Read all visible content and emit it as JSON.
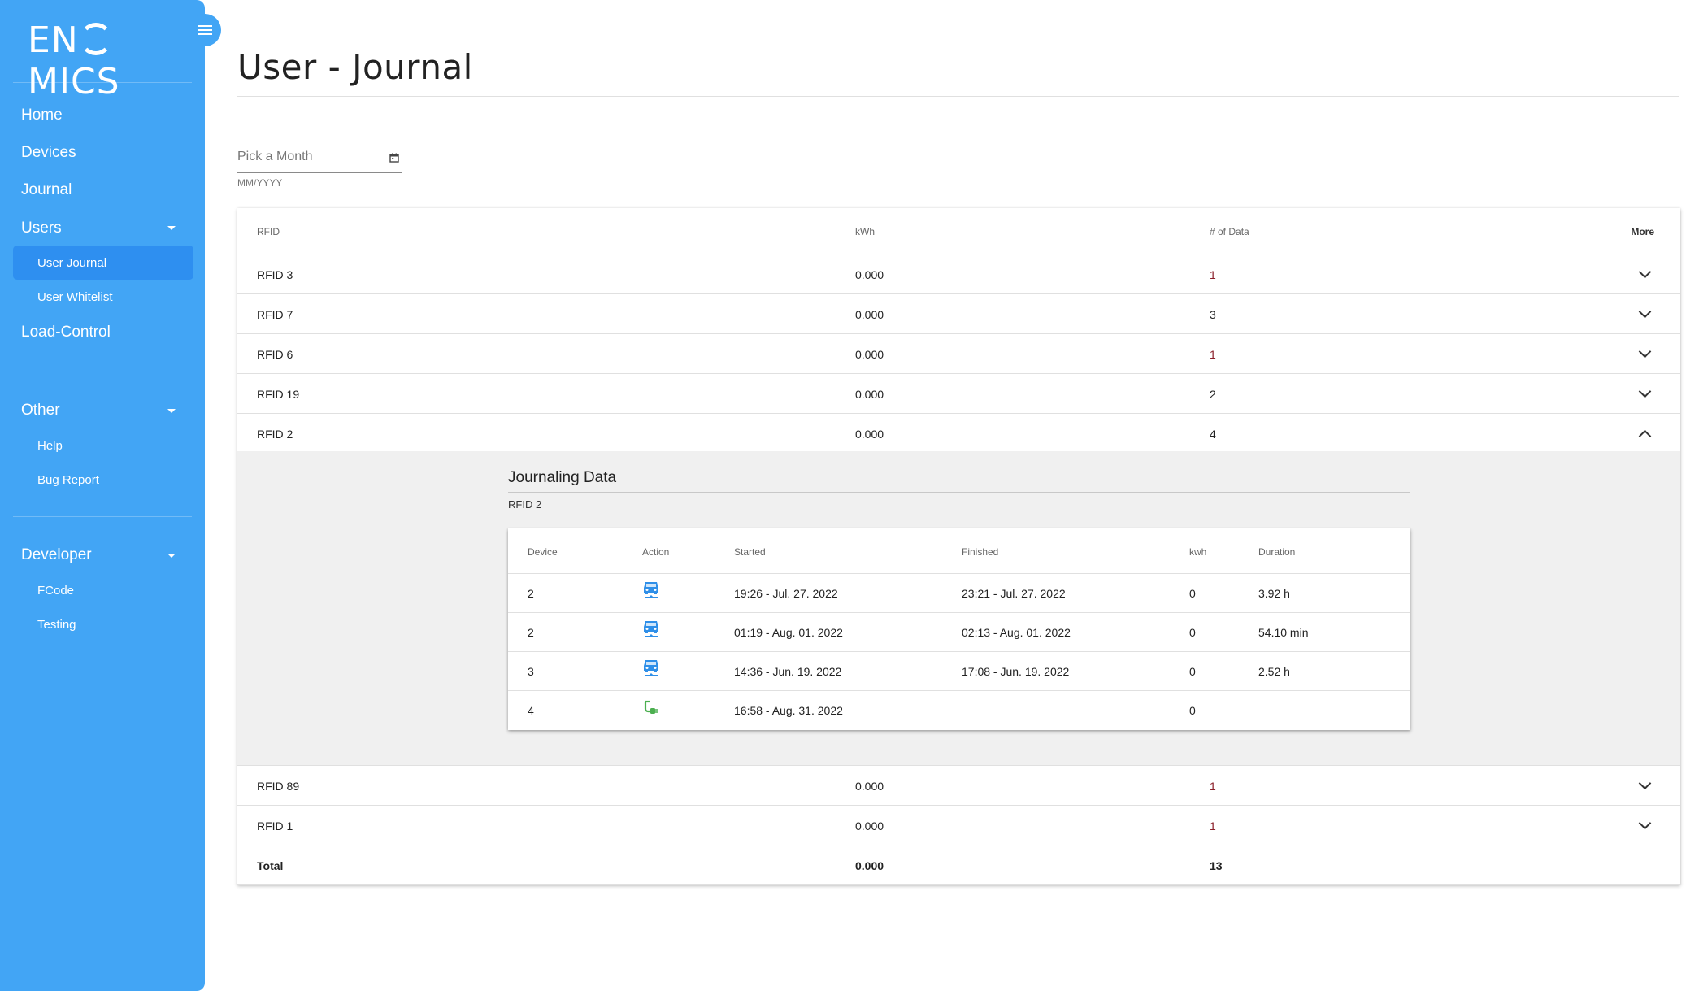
{
  "brand": {
    "logo_text_1": "EN",
    "logo_text_2": "MICS"
  },
  "sidebar": {
    "items": [
      {
        "label": "Home"
      },
      {
        "label": "Devices"
      },
      {
        "label": "Journal"
      },
      {
        "label": "Users"
      },
      {
        "label": "Load-Control"
      },
      {
        "label": "Other"
      },
      {
        "label": "Developer"
      }
    ],
    "users_sub": [
      {
        "label": "User Journal"
      },
      {
        "label": "User Whitelist"
      }
    ],
    "other_sub": [
      {
        "label": "Help"
      },
      {
        "label": "Bug Report"
      }
    ],
    "developer_sub": [
      {
        "label": "FCode"
      },
      {
        "label": "Testing"
      }
    ]
  },
  "page": {
    "title": "User - Journal"
  },
  "month_picker": {
    "placeholder": "Pick a Month",
    "hint": "MM/YYYY"
  },
  "table": {
    "headers": {
      "rfid": "RFID",
      "kwh": "kWh",
      "num": "# of Data",
      "more": "More"
    },
    "rows": [
      {
        "rfid": "RFID 3",
        "kwh": "0.000",
        "num": "1"
      },
      {
        "rfid": "RFID 7",
        "kwh": "0.000",
        "num": "3"
      },
      {
        "rfid": "RFID 6",
        "kwh": "0.000",
        "num": "1"
      },
      {
        "rfid": "RFID 19",
        "kwh": "0.000",
        "num": "2"
      },
      {
        "rfid": "RFID 2",
        "kwh": "0.000",
        "num": "4"
      },
      {
        "rfid": "RFID 89",
        "kwh": "0.000",
        "num": "1"
      },
      {
        "rfid": "RFID 1",
        "kwh": "0.000",
        "num": "1"
      }
    ],
    "total": {
      "label": "Total",
      "kwh": "0.000",
      "num": "13"
    }
  },
  "journaling": {
    "title": "Journaling Data",
    "subtitle": "RFID 2",
    "headers": {
      "device": "Device",
      "action": "Action",
      "started": "Started",
      "finished": "Finished",
      "kwh": "kwh",
      "duration": "Duration"
    },
    "rows": [
      {
        "device": "2",
        "action_icon": "car-icon",
        "started": "19:26 - Jul. 27. 2022",
        "finished": "23:21 - Jul. 27. 2022",
        "kwh": "0",
        "duration": "3.92 h"
      },
      {
        "device": "2",
        "action_icon": "car-icon",
        "started": "01:19 - Aug. 01. 2022",
        "finished": "02:13 - Aug. 01. 2022",
        "kwh": "0",
        "duration": "54.10 min"
      },
      {
        "device": "3",
        "action_icon": "car-icon",
        "started": "14:36 - Jun. 19. 2022",
        "finished": "17:08 - Jun. 19. 2022",
        "kwh": "0",
        "duration": "2.52 h"
      },
      {
        "device": "4",
        "action_icon": "plug-icon",
        "started": "16:58 - Aug. 31. 2022",
        "finished": "",
        "kwh": "0",
        "duration": ""
      }
    ]
  },
  "colors": {
    "sidebar": "#42a5f5",
    "active": "#2e8ff0",
    "car_icon": "#2f8fe8",
    "plug_icon": "#4caf50",
    "data_count": "#8b1f2a"
  }
}
